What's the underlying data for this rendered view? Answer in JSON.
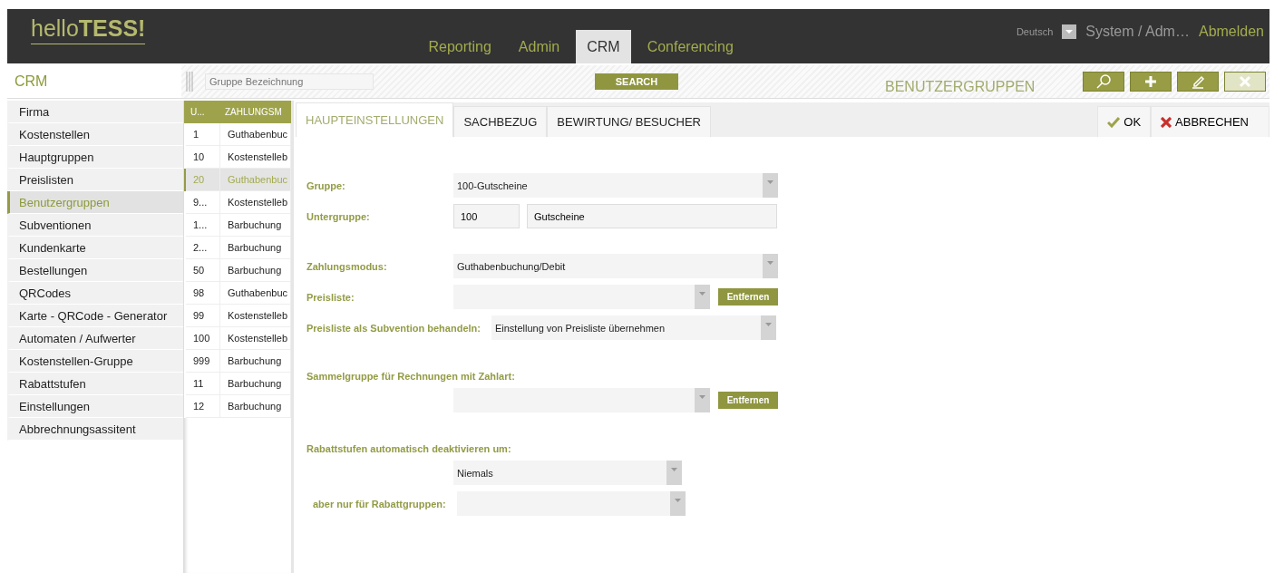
{
  "header": {
    "logo": "hello**TESS!**",
    "nav": [
      {
        "label": "Reporting",
        "selected": false
      },
      {
        "label": "Admin",
        "selected": false
      },
      {
        "label": "CRM",
        "selected": true
      },
      {
        "label": "Conferencing",
        "selected": false
      }
    ],
    "language": "Deutsch",
    "user": "System / Adm…",
    "logout": "Abmelden"
  },
  "toolbar": {
    "module": "CRM",
    "search_placeholder": "Gruppe Bezeichnung",
    "search_button": "SEARCH",
    "title": "BENUTZERGRUPPEN",
    "tools": [
      {
        "kind": "search",
        "disabled": false
      },
      {
        "kind": "add",
        "disabled": false
      },
      {
        "kind": "edit",
        "disabled": false
      },
      {
        "kind": "delete",
        "disabled": true
      }
    ]
  },
  "sidebar": {
    "items": [
      {
        "label": "Firma",
        "selected": false
      },
      {
        "label": "Kostenstellen",
        "selected": false
      },
      {
        "label": "Hauptgruppen",
        "selected": false
      },
      {
        "label": "Preislisten",
        "selected": false
      },
      {
        "label": "Benutzergruppen",
        "selected": true
      },
      {
        "label": "Subventionen",
        "selected": false
      },
      {
        "label": "Kundenkarte",
        "selected": false
      },
      {
        "label": "Bestellungen",
        "selected": false
      },
      {
        "label": "QRCodes",
        "selected": false
      },
      {
        "label": "Karte - QRCode - Generator",
        "selected": false
      },
      {
        "label": "Automaten / Aufwerter",
        "selected": false
      },
      {
        "label": "Kostenstellen-Gruppe",
        "selected": false
      },
      {
        "label": "Rabattstufen",
        "selected": false
      },
      {
        "label": "Einstellungen",
        "selected": false
      },
      {
        "label": "Abbrechnungsassitent",
        "selected": false
      }
    ]
  },
  "table": {
    "columns": [
      "U...",
      "ZAHLUNGSM"
    ],
    "rows": [
      {
        "cells": [
          "1",
          "Guthabenbuc"
        ],
        "selected": false
      },
      {
        "cells": [
          "10",
          "Kostenstelleb"
        ],
        "selected": false
      },
      {
        "cells": [
          "20",
          "Guthabenbuc"
        ],
        "selected": true
      },
      {
        "cells": [
          "9...",
          "Kostenstelleb"
        ],
        "selected": false
      },
      {
        "cells": [
          "1...",
          "Barbuchung"
        ],
        "selected": false
      },
      {
        "cells": [
          "2...",
          "Barbuchung"
        ],
        "selected": false
      },
      {
        "cells": [
          "50",
          "Barbuchung"
        ],
        "selected": false
      },
      {
        "cells": [
          "98",
          "Guthabenbuc"
        ],
        "selected": false
      },
      {
        "cells": [
          "99",
          "Kostenstelleb"
        ],
        "selected": false
      },
      {
        "cells": [
          "100",
          "Kostenstelleb"
        ],
        "selected": false
      },
      {
        "cells": [
          "999",
          "Barbuchung"
        ],
        "selected": false
      },
      {
        "cells": [
          "11",
          "Barbuchung"
        ],
        "selected": false
      },
      {
        "cells": [
          "12",
          "Barbuchung"
        ],
        "selected": false
      }
    ]
  },
  "tabs": [
    {
      "label": "HAUPTEINSTELLUNGEN",
      "selected": true
    },
    {
      "label": "SACHBEZUG",
      "selected": false
    },
    {
      "label": "BEWIRTUNG/ BESUCHER",
      "selected": false
    }
  ],
  "actions": [
    {
      "kind": "ok",
      "label": "OK"
    },
    {
      "kind": "cancel",
      "label": "ABBRECHEN"
    }
  ],
  "form": {
    "groups": [
      {
        "rows": [
          {
            "kind": "select",
            "label": "Gruppe:",
            "value": "100-Gutscheine"
          },
          {
            "kind": "pair",
            "label": "Untergruppe:",
            "values": [
              "100",
              "Gutscheine"
            ]
          }
        ]
      },
      {
        "rows": [
          {
            "kind": "select",
            "label": "Zahlungsmodus:",
            "value": "Guthabenbuchung/Debit"
          },
          {
            "kind": "select-button",
            "label": "Preisliste:",
            "button": "Entfernen"
          },
          {
            "kind": "select",
            "label": "Preisliste als Subvention behandeln:",
            "value": "Einstellung von Preisliste übernehmen"
          }
        ]
      },
      {
        "rows": [
          {
            "kind": "heading",
            "label": "Sammelgruppe für Rechnungen mit Zahlart:"
          },
          {
            "kind": "select-button",
            "button": "Entfernen"
          }
        ]
      },
      {
        "rows": [
          {
            "kind": "heading",
            "label": "Rabattstufen automatisch deaktivieren um:"
          },
          {
            "kind": "select-short",
            "value": "Niemals"
          },
          {
            "kind": "select-short",
            "label": "aber nur für Rabattgruppen:"
          }
        ]
      }
    ]
  }
}
